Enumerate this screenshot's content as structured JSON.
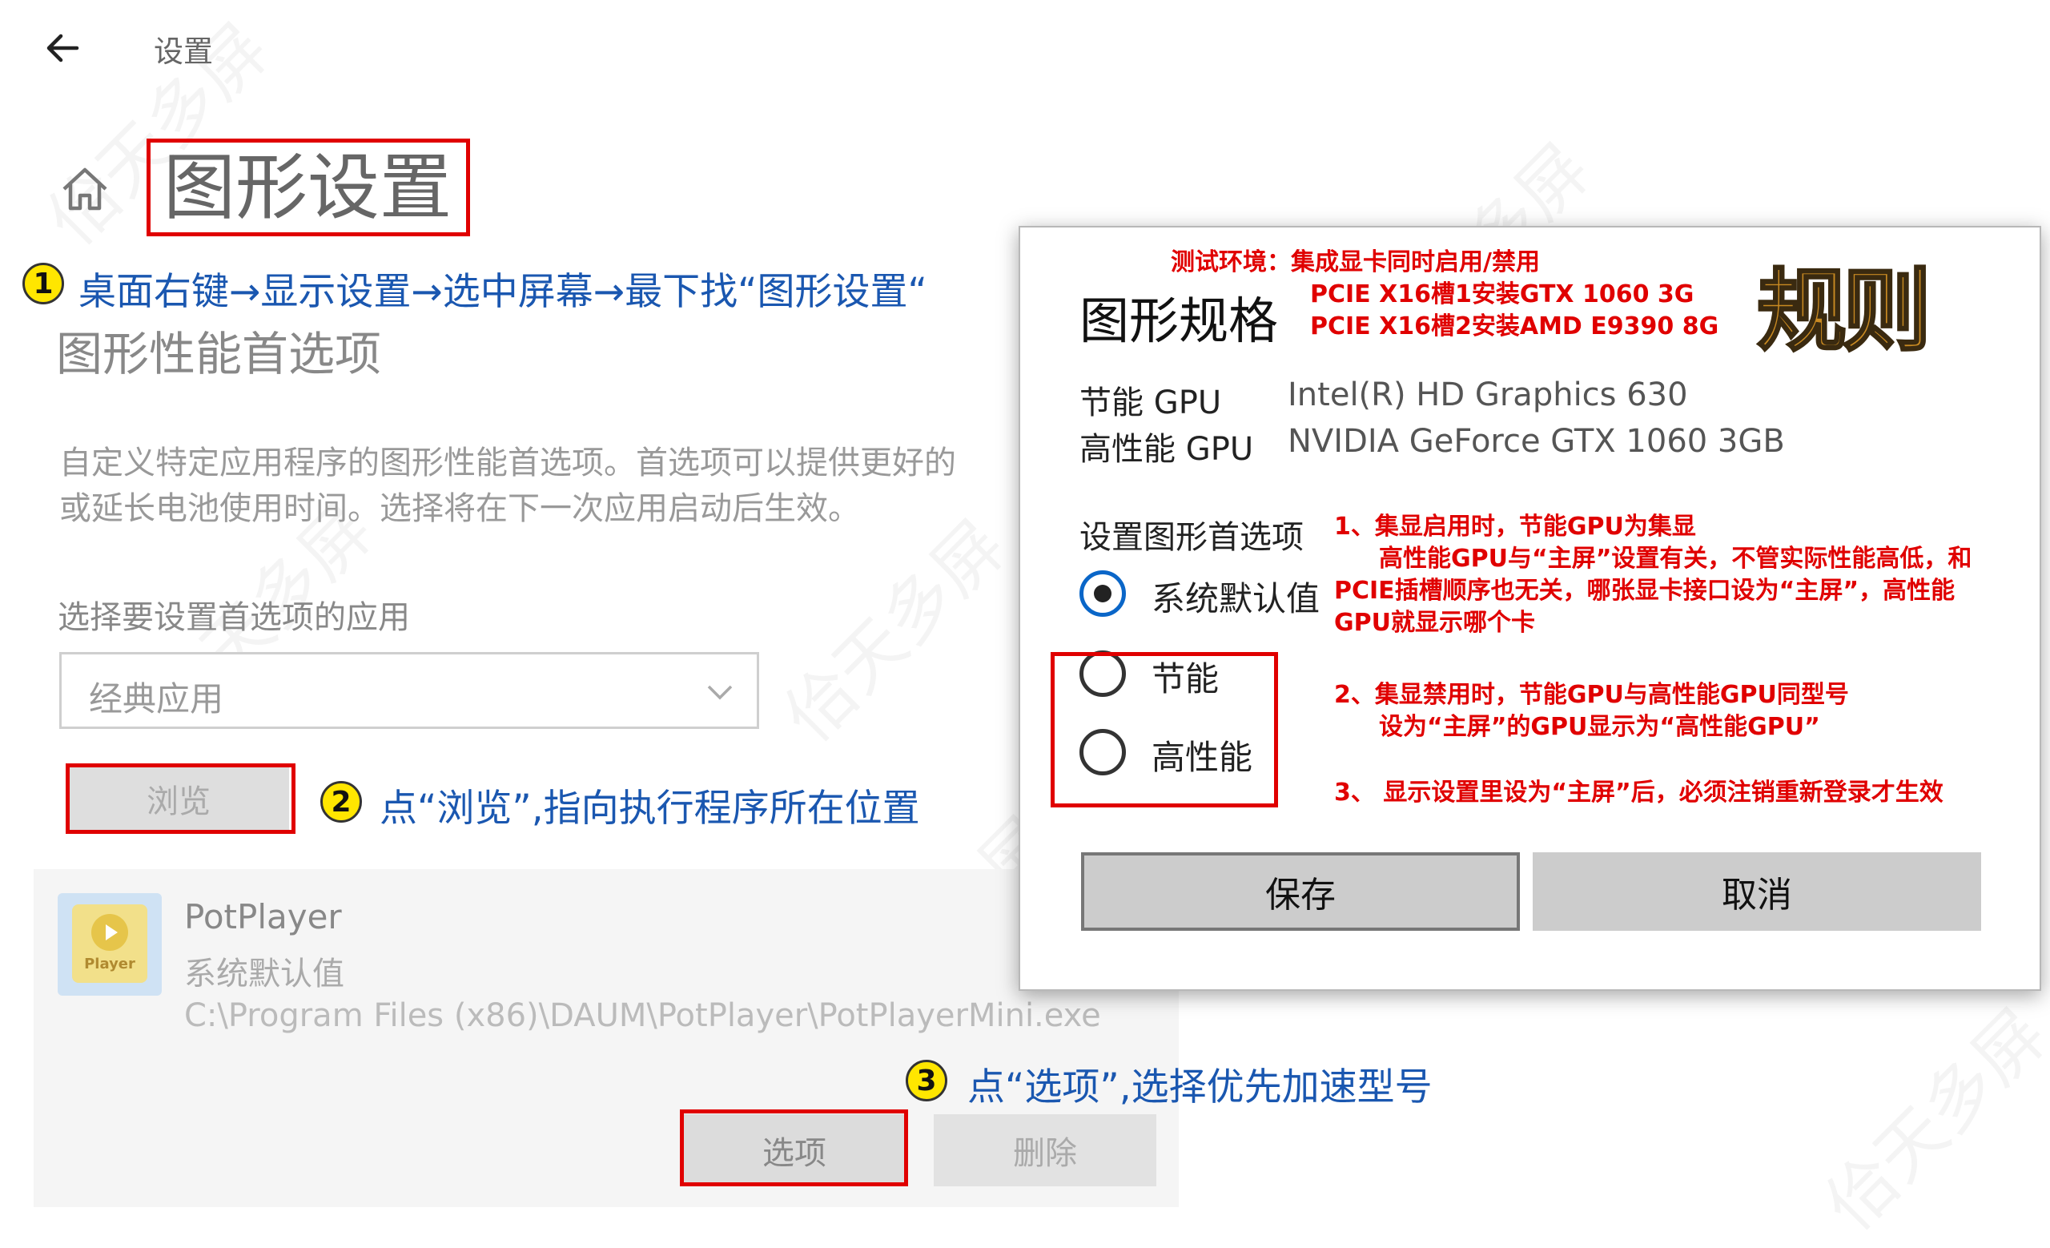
{
  "header": {
    "back_icon": "arrow-left-icon",
    "title": "设置"
  },
  "page": {
    "home_icon": "home-icon",
    "title": "图形设置"
  },
  "section": {
    "heading": "图形性能首选项",
    "description_line1": "自定义特定应用程序的图形性能首选项。首选项可以提供更好的",
    "description_line2": "或延长电池使用时间。选择将在下一次应用启动后生效。",
    "select_label": "选择要设置首选项的应用",
    "select_value": "经典应用",
    "browse_label": "浏览"
  },
  "app_item": {
    "name": "PotPlayer",
    "preference": "系统默认值",
    "path": "C:\\Program Files (x86)\\DAUM\\PotPlayer\\PotPlayerMini.exe",
    "icon_text": "Player",
    "options_label": "选项",
    "delete_label": "删除"
  },
  "annotations": {
    "step1_num": "1",
    "step1_text": "桌面右键→显示设置→选中屏幕→最下找“图形设置“",
    "step2_num": "2",
    "step2_text": "点“浏览”,指向执行程序所在位置",
    "step3_num": "3",
    "step3_text": "点“选项”,选择优先加速型号"
  },
  "dialog": {
    "title": "图形规格",
    "test_env_line1": "测试环境：集成显卡同时启用/禁用",
    "test_env_line2": "PCIE X16槽1安装GTX 1060 3G",
    "test_env_line3": "PCIE X16槽2安装AMD E9390 8G",
    "stamp": "规则",
    "power_gpu_label": "节能 GPU",
    "power_gpu_value": "Intel(R) HD Graphics 630",
    "perf_gpu_label": "高性能 GPU",
    "perf_gpu_value": "NVIDIA GeForce GTX 1060 3GB",
    "pref_label": "设置图形首选项",
    "options": [
      {
        "label": "系统默认值",
        "checked": true
      },
      {
        "label": "节能",
        "checked": false
      },
      {
        "label": "高性能",
        "checked": false
      }
    ],
    "save_label": "保存",
    "cancel_label": "取消",
    "note1_line1": "1、集显启用时，节能GPU为集显",
    "note1_line2": "高性能GPU与“主屏”设置有关，不管实际性能高低，和",
    "note1_line3": "PCIE插槽顺序也无关，哪张显卡接口设为“主屏”，高性能",
    "note1_line4": "GPU就显示哪个卡",
    "note2_line1": "2、集显禁用时，节能GPU与高性能GPU同型号",
    "note2_line2": "设为“主屏”的GPU显示为“高性能GPU”",
    "note3": "3、 显示设置里设为“主屏”后，必须注销重新登录才生效"
  },
  "colors": {
    "annotation_red": "#e00000",
    "annotation_blue": "#1a57b0",
    "badge_yellow": "#ffe600",
    "radio_accent": "#0a66c8"
  }
}
